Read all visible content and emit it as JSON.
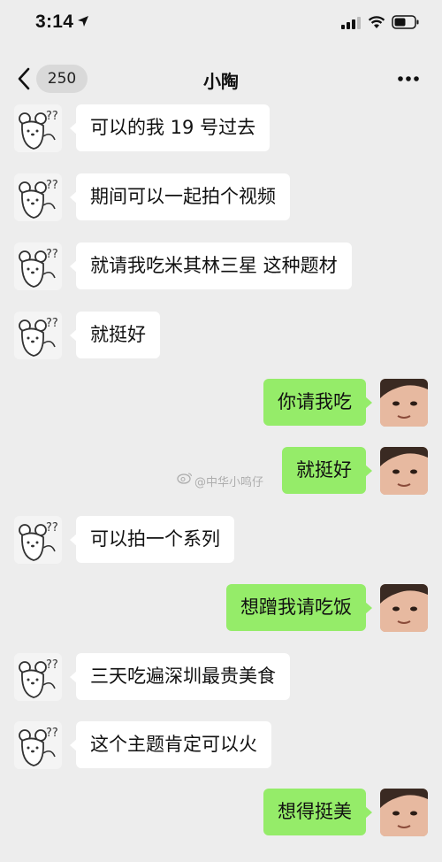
{
  "status": {
    "time": "3:14"
  },
  "nav": {
    "unread_count": "250",
    "title": "小陶"
  },
  "watermark": {
    "text": "@中华小鸣仔"
  },
  "messages": [
    {
      "side": "left",
      "text": "可以的我 19 号过去"
    },
    {
      "side": "left",
      "text": "期间可以一起拍个视频"
    },
    {
      "side": "left",
      "text": "就请我吃米其林三星 这种题材"
    },
    {
      "side": "left",
      "text": "就挺好"
    },
    {
      "side": "right",
      "text": "你请我吃"
    },
    {
      "side": "right",
      "text": "就挺好"
    },
    {
      "side": "left",
      "text": "可以拍一个系列"
    },
    {
      "side": "right",
      "text": "想蹭我请吃饭"
    },
    {
      "side": "left",
      "text": "三天吃遍深圳最贵美食"
    },
    {
      "side": "left",
      "text": "这个主题肯定可以火"
    },
    {
      "side": "right",
      "text": "想得挺美"
    }
  ],
  "colors": {
    "background": "#ededed",
    "incoming_bubble": "#ffffff",
    "outgoing_bubble": "#95ec69"
  },
  "icons": {
    "left_avatar": "cartoon-mouse-question-marks",
    "right_avatar": "child-face-photo"
  }
}
